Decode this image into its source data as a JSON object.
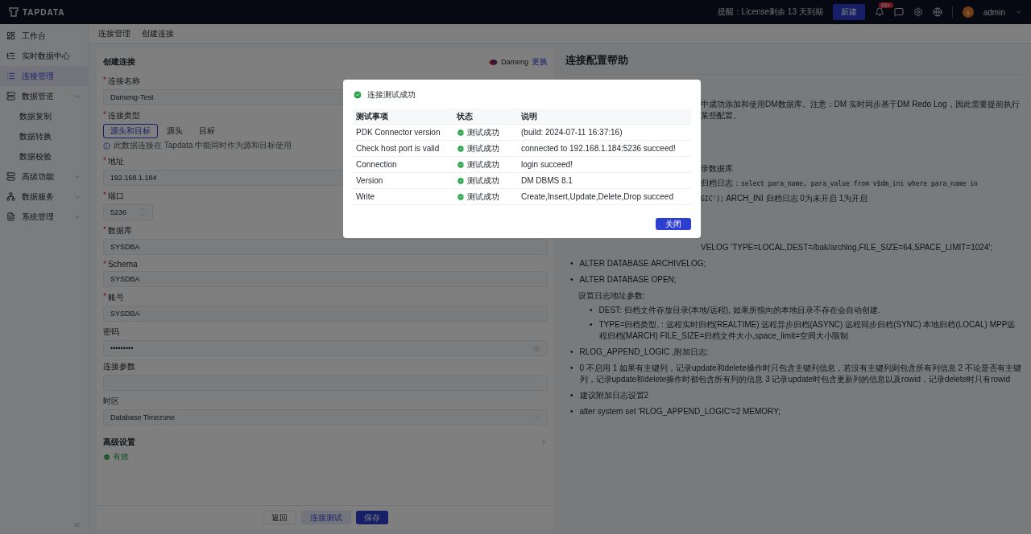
{
  "header": {
    "logo": "TAPDATA",
    "notice": "提醒：License剩余 13 天到期",
    "new_button": "新建",
    "badge": "99+",
    "avatar": "a",
    "user": "admin"
  },
  "sidebar": {
    "items": [
      {
        "label": "工作台",
        "selected": false
      },
      {
        "label": "实时数据中心",
        "selected": false
      },
      {
        "label": "连接管理",
        "selected": true
      },
      {
        "label": "数据管道",
        "selected": false,
        "expanded": true,
        "children": [
          {
            "label": "数据复制",
            "selected": false
          },
          {
            "label": "数据转换",
            "selected": false
          },
          {
            "label": "数据校验",
            "selected": false
          }
        ]
      },
      {
        "label": "高级功能",
        "selected": false,
        "expanded": false
      },
      {
        "label": "数据服务",
        "selected": false,
        "expanded": false
      },
      {
        "label": "系统管理",
        "selected": false,
        "expanded": false
      }
    ]
  },
  "breadcrumb": [
    "连接管理",
    "创建连接"
  ],
  "form": {
    "title": "创建连接",
    "connector": "Dameng",
    "change_link": "更换",
    "fields": [
      {
        "kind": "input",
        "label": "连接名称",
        "required_mark": "*",
        "value": "Dameng-Test"
      },
      {
        "kind": "segment",
        "label": "连接类型",
        "required_mark": "*",
        "options": [
          {
            "label": "源头和目标",
            "selected": true
          },
          {
            "label": "源头",
            "selected": false
          },
          {
            "label": "目标",
            "selected": false
          }
        ],
        "hint": "此数据连接在 Tapdata 中能同时作为源和目标使用"
      },
      {
        "kind": "input",
        "label": "地址",
        "required_mark": "*",
        "value": "192.168.1.184"
      },
      {
        "kind": "number",
        "label": "端口",
        "required_mark": "*",
        "value": "5236"
      },
      {
        "kind": "input",
        "label": "数据库",
        "required_mark": "*",
        "value": "SYSDBA"
      },
      {
        "kind": "input",
        "label": "Schema",
        "required_mark": "*",
        "value": "SYSDBA"
      },
      {
        "kind": "input",
        "label": "账号",
        "required_mark": "*",
        "value": "SYSDBA"
      },
      {
        "kind": "password",
        "label": "密码",
        "value": "•••••••••"
      },
      {
        "kind": "input",
        "label": "连接参数"
      },
      {
        "kind": "select",
        "label": "时区",
        "value": "Database Timezone"
      }
    ],
    "advanced": "高级设置",
    "status": "有效",
    "buttons": [
      {
        "label": "返回",
        "kind": "default"
      },
      {
        "label": "连接测试",
        "kind": "secondary"
      },
      {
        "label": "保存",
        "kind": "primary"
      }
    ]
  },
  "help": {
    "title": "连接配置帮助",
    "lines": [
      {
        "kind": "intro",
        "segments": [
          {
            "text": "中成功添加和使用DM数据库。注意：DM 实时同步基于DM Redo Log，因此需要提前执行某些配置。",
            "code": false
          }
        ]
      },
      {
        "kind": "step",
        "segments": [
          {
            "text": "录数据库",
            "code": false
          }
        ]
      },
      {
        "kind": "code",
        "segments": [
          {
            "text": "归档日志：",
            "code": false
          },
          {
            "text": "select para_name, para_value from v$dm_ini where para_name in",
            "code": true
          }
        ]
      },
      {
        "kind": "code",
        "segments": [
          {
            "text": "GIC');",
            "code": true
          },
          {
            "text": " ARCH_INI 归档日志 0为未开启 1为开启",
            "code": false
          }
        ]
      },
      {
        "kind": "command",
        "segments": [
          {
            "text": "VELOG 'TYPE=LOCAL,DEST=/bak/archlog,FILE_SIZE=64,SPACE_LIMIT=1024';",
            "code": false
          }
        ]
      },
      {
        "kind": "bullet",
        "marker": "•",
        "segments": [
          {
            "text": "ALTER DATABASE ARCHIVELOG;",
            "code": false
          }
        ]
      },
      {
        "kind": "bullet",
        "marker": "•",
        "segments": [
          {
            "text": "ALTER DATABASE OPEN;",
            "code": false
          }
        ]
      },
      {
        "kind": "text",
        "segments": [
          {
            "text": "设置日志地址参数:",
            "code": false
          }
        ]
      },
      {
        "kind": "sub",
        "marker": "•",
        "segments": [
          {
            "text": "DEST: 归档文件存放目录(本地/远程), 如果所指向的本地目录不存在会自动创建.",
            "code": false
          }
        ]
      },
      {
        "kind": "sub",
        "marker": "•",
        "segments": [
          {
            "text": "TYPE=归档类型, : 远程实时归档(REALTIME) 远程异步归档(ASYNC) 远程同步归档(SYNC) 本地归档(LOCAL) MPP远程归档(MARCH) FILE_SIZE=归档文件大小,space_limit=空间大小限制",
            "code": false
          }
        ]
      },
      {
        "kind": "bullet",
        "marker": "•",
        "segments": [
          {
            "text": "RLOG_APPEND_LOGIC ,附加日志:",
            "code": false
          }
        ]
      },
      {
        "kind": "bullet",
        "marker": "•",
        "segments": [
          {
            "text": "0 不启用 1 如果有主键列，记录update和delete操作时只包含主键列信息，若没有主键列则包含所有列信息 2 不论是否有主键列，记录update和delete操作时都包含所有列的信息 3 记录update时包含更新列的信息以及rowid，记录delete时只有rowid",
            "code": false
          }
        ]
      },
      {
        "kind": "bullet",
        "marker": "•",
        "segments": [
          {
            "text": "建议附加日志设置2",
            "code": false
          }
        ]
      },
      {
        "kind": "bullet",
        "marker": "•",
        "segments": [
          {
            "text": "alter system set 'RLOG_APPEND_LOGIC'=2 MEMORY;",
            "code": false
          }
        ]
      }
    ]
  },
  "modal": {
    "title": "连接测试成功",
    "columns": [
      "测试事项",
      "状态",
      "说明"
    ],
    "rows": [
      {
        "item": "PDK Connector version",
        "status": "测试成功",
        "note": "(build: 2024-07-11 16:37:16)"
      },
      {
        "item": "Check host port is valid",
        "status": "测试成功",
        "note": "connected to 192.168.1.184:5236 succeed!"
      },
      {
        "item": "Connection",
        "status": "测试成功",
        "note": "login succeed!"
      },
      {
        "item": "Version",
        "status": "测试成功",
        "note": "DM DBMS 8.1"
      },
      {
        "item": "Write",
        "status": "测试成功",
        "note": "Create,Insert,Update,Delete,Drop succeed"
      }
    ],
    "close": "关闭"
  }
}
